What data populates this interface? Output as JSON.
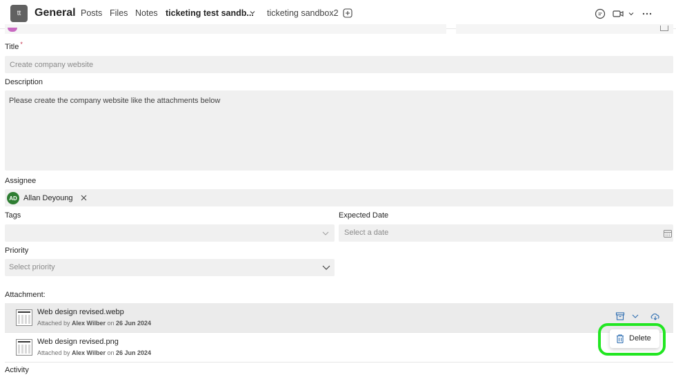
{
  "header": {
    "team_initials": "tt",
    "channel": "General",
    "tabs": [
      "Posts",
      "Files",
      "Notes",
      "ticketing test sandb...",
      "ticketing sandbox2"
    ]
  },
  "form": {
    "title_label": "Title",
    "title_required_mark": "*",
    "title_placeholder": "Create company website",
    "description_label": "Description",
    "description_value": "Please create the company website like the attachments below",
    "assignee_label": "Assignee",
    "assignee": {
      "initials": "AD",
      "name": "Allan Deyoung",
      "avatar_color": "#2e7d32"
    },
    "tags_label": "Tags",
    "expected_date_label": "Expected Date",
    "expected_date_placeholder": "Select a date",
    "priority_label": "Priority",
    "priority_placeholder": "Select priority",
    "attachment_label": "Attachment:",
    "attachments": [
      {
        "name": "Web design revised.webp",
        "attached_by_prefix": "Attached by",
        "author": "Alex Wilber",
        "on": "on",
        "date": "26 Jun 2024"
      },
      {
        "name": "Web design revised.png",
        "attached_by_prefix": "Attached by",
        "author": "Alex Wilber",
        "on": "on",
        "date": "26 Jun 2024"
      }
    ],
    "activity_label": "Activity"
  },
  "context_menu": {
    "delete_label": "Delete"
  },
  "colors": {
    "accent": "#3b3fa9",
    "highlight": "#22e622",
    "icon_blue": "#2b6cb0"
  }
}
